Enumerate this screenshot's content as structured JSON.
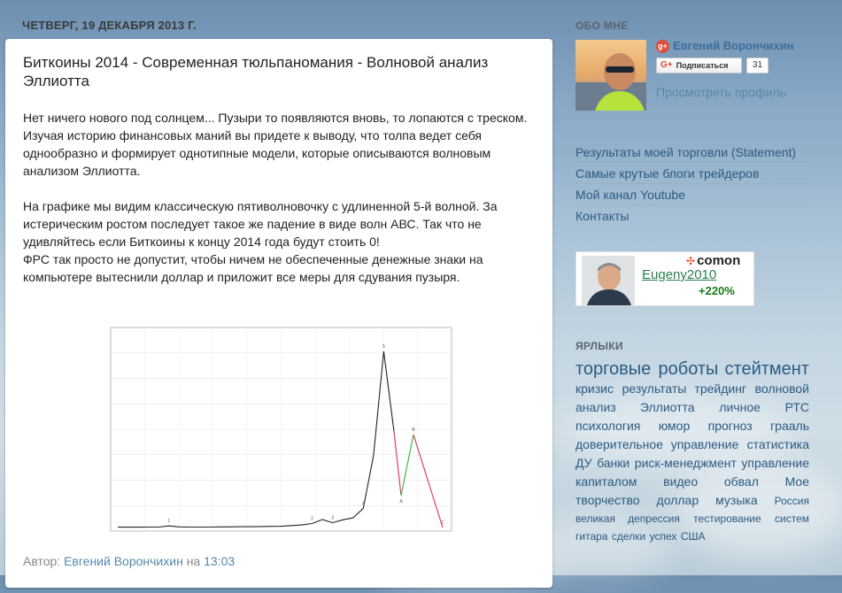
{
  "post": {
    "date": "ЧЕТВЕРГ, 19 ДЕКАБРЯ 2013 Г.",
    "title": "Биткоины 2014 - Современная тюльпаномания - Волновой анализ Эллиотта",
    "paragraphs": [
      "Нет ничего нового под солнцем... Пузыри то появляются вновь, то лопаются с треском.",
      "Изучая историю финансовых маний вы придете к выводу, что толпа ведет себя однообразно и формирует однотипные модели, которые описываются волновым анализом Эллиотта.",
      "",
      "На графике мы видим классическую пятиволновочку с удлиненной 5-й волной. За истерическим ростом последует такое же падение в виде волн АВС. Так что не удивляйтесь если Биткоины к концу 2014 года будут стоить 0!",
      "ФРС так просто не допустит, чтобы ничем не обеспеченные денежные знаки на компьютере вытеснили доллар и приложит все меры для сдувания пузыря."
    ],
    "footer": {
      "author_prefix": "Автор:",
      "author": "Евгений Ворончихин",
      "time_prefix": "на",
      "time": "13:03"
    }
  },
  "chart_data": {
    "type": "line",
    "series": [
      {
        "values": [
          2,
          2,
          2,
          3,
          3,
          10,
          4,
          3,
          3,
          3,
          4,
          4,
          5,
          5,
          6,
          7,
          8,
          12,
          16,
          25,
          50,
          30,
          48,
          60,
          120,
          450,
          1100,
          600
        ]
      },
      {
        "values": [
          600,
          200,
          580,
          0
        ]
      }
    ],
    "wave_labels": [
      "1",
      "2",
      "3",
      "4",
      "5",
      "A",
      "B",
      "C"
    ],
    "colors": {
      "price": "#222222",
      "wave_a": "#e0405a",
      "wave_b": "#3ab64a",
      "wave_c": "#e0405a"
    }
  },
  "sidebar": {
    "about_title": "ОБО МНЕ",
    "profile_name": "Евгений Ворончихин",
    "subscribe_label": "Подписаться",
    "subscribe_count": "31",
    "view_profile": "Просмотреть профиль",
    "links": [
      "Результаты моей торговли (Statement)",
      "Самые крутые блоги трейдеров",
      "Мой канал Youtube",
      "Контакты"
    ],
    "comon": {
      "logo": "comon",
      "user": "Eugeny2010",
      "percent": "+220%"
    },
    "labels_title": "ЯРЛЫКИ",
    "labels": [
      {
        "text": "торговые роботы",
        "size": 5
      },
      {
        "text": "стейтмент",
        "size": 5
      },
      {
        "text": "кризис",
        "size": 2
      },
      {
        "text": "результаты трейдинг",
        "size": 2
      },
      {
        "text": "волновой анализ Эллиотта",
        "size": 2
      },
      {
        "text": "личное",
        "size": 2
      },
      {
        "text": "РТС",
        "size": 2
      },
      {
        "text": "психология",
        "size": 2
      },
      {
        "text": "юмор",
        "size": 2
      },
      {
        "text": "прогноз",
        "size": 2
      },
      {
        "text": "грааль",
        "size": 2
      },
      {
        "text": "доверительное управление",
        "size": 2
      },
      {
        "text": "статистика",
        "size": 2
      },
      {
        "text": "ДУ",
        "size": 2
      },
      {
        "text": "банки",
        "size": 2
      },
      {
        "text": "риск-менеджмент",
        "size": 2
      },
      {
        "text": "управление капиталом",
        "size": 2
      },
      {
        "text": "видео",
        "size": 2
      },
      {
        "text": "обвал",
        "size": 2
      },
      {
        "text": "Мое творчество",
        "size": 2
      },
      {
        "text": "доллар",
        "size": 2
      },
      {
        "text": "музыка",
        "size": 2
      },
      {
        "text": "Россия",
        "size": 1
      },
      {
        "text": "великая депрессия",
        "size": 1
      },
      {
        "text": "тестирование",
        "size": 1
      },
      {
        "text": "систем",
        "size": 1
      },
      {
        "text": "гитара",
        "size": 1
      },
      {
        "text": "сделки",
        "size": 1
      },
      {
        "text": "успех",
        "size": 1
      },
      {
        "text": "США",
        "size": 1
      }
    ]
  }
}
